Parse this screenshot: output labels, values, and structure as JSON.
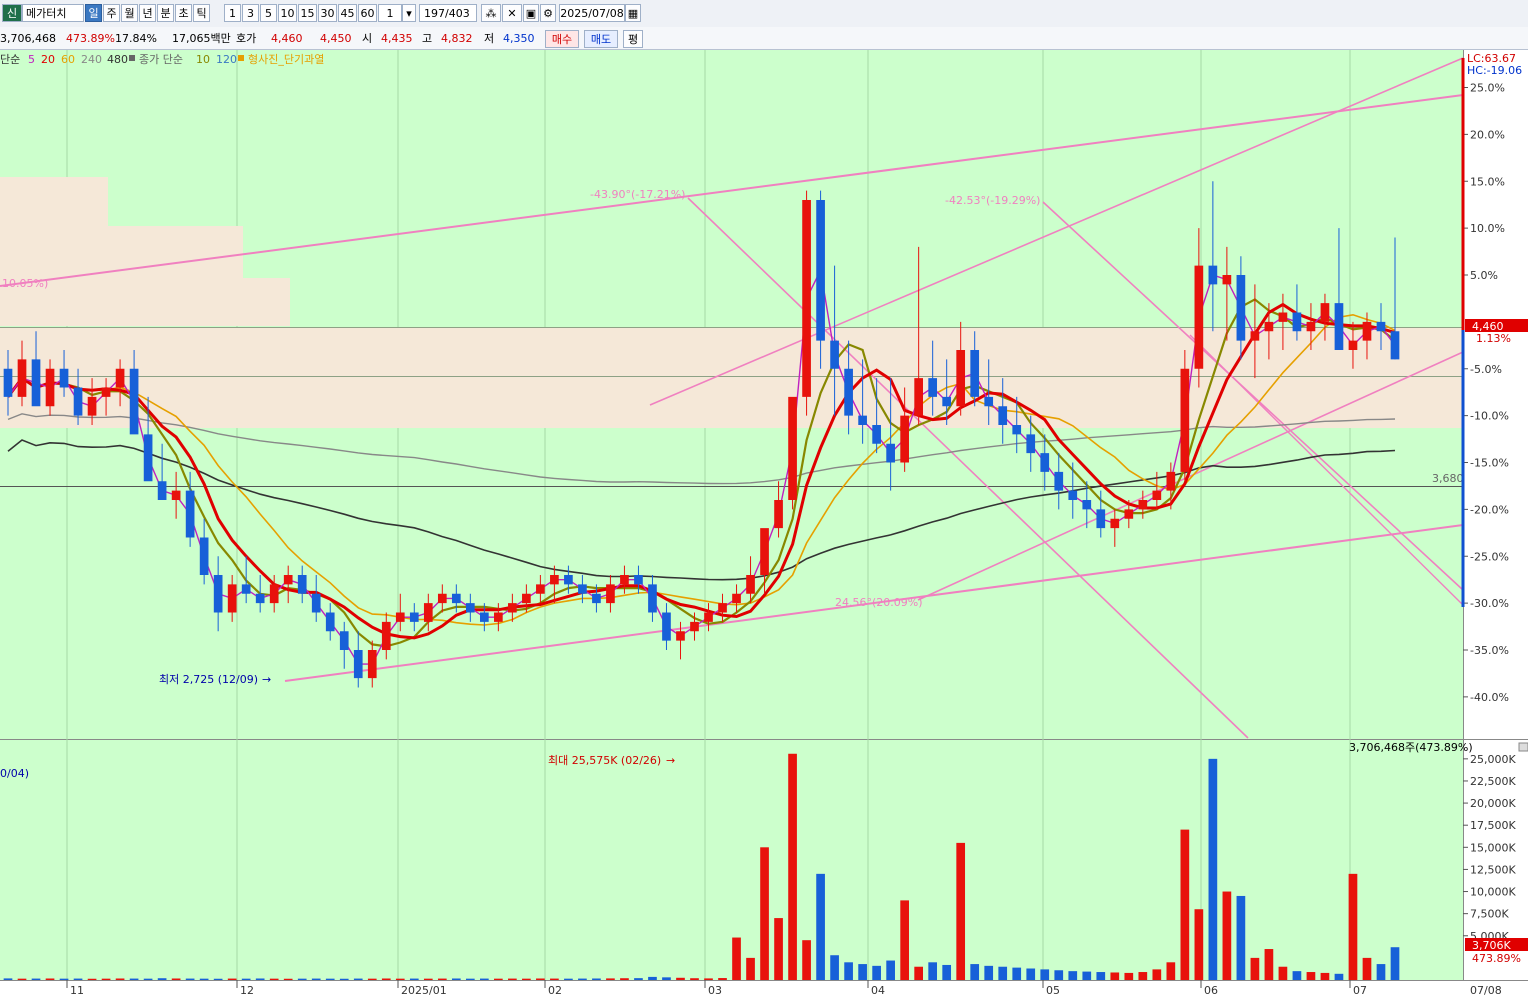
{
  "toolbar": {
    "stock_badge": "신",
    "stock_name": "메가터치",
    "periods": [
      "일",
      "주",
      "월",
      "년",
      "분",
      "초",
      "틱"
    ],
    "selected_period": "일",
    "intervals": [
      "1",
      "3",
      "5",
      "10",
      "15",
      "30",
      "45",
      "60"
    ],
    "interval_value": "1",
    "count_current": "197",
    "count_total": "/403",
    "date": "2025/07/08"
  },
  "info": {
    "volume": "3,706,468",
    "vol_ratio": "473.89%",
    "rate": "17.84%",
    "amount": "17,065백만",
    "hoga_label": "호가",
    "ask": "4,460",
    "bid": "4,450",
    "open_label": "시",
    "open": "4,435",
    "high_label": "고",
    "high": "4,832",
    "low_label": "저",
    "low": "4,350",
    "buy_btn": "매수",
    "sell_btn": "매도",
    "avg_btn": "평"
  },
  "legend": {
    "price_ma_label": "단순",
    "price_ma_periods": [
      "5",
      "20",
      "60",
      "240",
      "480"
    ],
    "price_ma_colors": [
      "#c020c0",
      "#e00000",
      "#e6a000",
      "#888888",
      "#333333"
    ],
    "volume_ma_label": "종가 단순",
    "volume_ma_periods": [
      "10",
      "120"
    ],
    "pattern_label": "형사진_단기과열"
  },
  "annotations": {
    "angle_1": "-43.90°(-17.21%)",
    "angle_2": "-42.53°(-19.29%)",
    "angle_3": "24.56°(20.09%)",
    "angle_left": "10.05%)",
    "low_marker": "최저 2,725 (12/09)",
    "max_volume": "최대 25,575K (02/26)",
    "vol_date_left": "0/04)",
    "ref_price": "3,680",
    "lc": "LC:63.67",
    "hc": "HC:-19.06",
    "last_price": "4,460",
    "last_pct": "1.13%",
    "vol_current": "3,706,468주(473.89%)",
    "vol_tag": "3,706K",
    "vol_tag_pct": "473.89%"
  },
  "chart_data": {
    "type": "candlestick",
    "title": "",
    "x_axis_ticks": [
      "11",
      "12",
      "2025/01",
      "02",
      "03",
      "04",
      "05",
      "06",
      "07",
      "07/08"
    ],
    "price_axis": {
      "format": "percent",
      "ticks": [
        "25.0%",
        "20.0%",
        "15.0%",
        "10.0%",
        "5.0%",
        "-5.0%",
        "-10.0%",
        "-15.0%",
        "-20.0%",
        "-25.0%",
        "-30.0%",
        "-35.0%",
        "-40.0%"
      ]
    },
    "volume_axis": {
      "unit": "K",
      "ticks": [
        "25,000K",
        "22,500K",
        "20,000K",
        "17,500K",
        "15,000K",
        "12,500K",
        "10,000K",
        "7,500K",
        "5,000K"
      ],
      "ylim": [
        0,
        26000
      ]
    },
    "price_ylim": [
      -44.6,
      29.0
    ],
    "candles_pct": [
      [
        -5,
        -3,
        -10,
        -8
      ],
      [
        -8,
        -2,
        -9,
        -4
      ],
      [
        -4,
        -1,
        -8,
        -9
      ],
      [
        -9,
        -4,
        -10,
        -5
      ],
      [
        -5,
        -3,
        -8,
        -7
      ],
      [
        -7,
        -5,
        -11,
        -10
      ],
      [
        -10,
        -6,
        -11,
        -8
      ],
      [
        -8,
        -6,
        -10,
        -7
      ],
      [
        -7,
        -4,
        -9,
        -5
      ],
      [
        -5,
        -3,
        -10,
        -12
      ],
      [
        -12,
        -8,
        -13,
        -17
      ],
      [
        -17,
        -13,
        -19,
        -19
      ],
      [
        -19,
        -16,
        -21,
        -18
      ],
      [
        -18,
        -16,
        -24,
        -23
      ],
      [
        -23,
        -21,
        -28,
        -27
      ],
      [
        -27,
        -25,
        -33,
        -31
      ],
      [
        -31,
        -27,
        -32,
        -28
      ],
      [
        -28,
        -25,
        -30,
        -29
      ],
      [
        -29,
        -27,
        -31,
        -30
      ],
      [
        -30,
        -27,
        -31,
        -28
      ],
      [
        -28,
        -26,
        -30,
        -27
      ],
      [
        -27,
        -26,
        -30,
        -29
      ],
      [
        -29,
        -27,
        -32,
        -31
      ],
      [
        -31,
        -30,
        -34,
        -33
      ],
      [
        -33,
        -32,
        -37,
        -35
      ],
      [
        -35,
        -33,
        -39,
        -38
      ],
      [
        -38,
        -34,
        -39,
        -35
      ],
      [
        -35,
        -31,
        -36,
        -32
      ],
      [
        -32,
        -29,
        -33,
        -31
      ],
      [
        -31,
        -30,
        -33,
        -32
      ],
      [
        -32,
        -29,
        -33,
        -30
      ],
      [
        -30,
        -28,
        -31,
        -29
      ],
      [
        -29,
        -28,
        -31,
        -30
      ],
      [
        -30,
        -29,
        -32,
        -31
      ],
      [
        -31,
        -30,
        -33,
        -32
      ],
      [
        -32,
        -30,
        -33,
        -31
      ],
      [
        -31,
        -29,
        -32,
        -30
      ],
      [
        -30,
        -28,
        -31,
        -29
      ],
      [
        -29,
        -27,
        -30,
        -28
      ],
      [
        -28,
        -26,
        -30,
        -27
      ],
      [
        -27,
        -26,
        -29,
        -28
      ],
      [
        -28,
        -27,
        -30,
        -29
      ],
      [
        -29,
        -28,
        -31,
        -30
      ],
      [
        -30,
        -27,
        -31,
        -28
      ],
      [
        -28,
        -26,
        -29,
        -27
      ],
      [
        -27,
        -26,
        -29,
        -28
      ],
      [
        -28,
        -27,
        -32,
        -31
      ],
      [
        -31,
        -30,
        -35,
        -34
      ],
      [
        -34,
        -32,
        -36,
        -33
      ],
      [
        -33,
        -31,
        -34,
        -32
      ],
      [
        -32,
        -30,
        -33,
        -31
      ],
      [
        -31,
        -29,
        -32,
        -30
      ],
      [
        -30,
        -28,
        -31,
        -29
      ],
      [
        -29,
        -25,
        -30,
        -27
      ],
      [
        -27,
        -23,
        -29,
        -22
      ],
      [
        -22,
        -17,
        -23,
        -19
      ],
      [
        -19,
        -9,
        -20,
        -8
      ],
      [
        -8,
        14,
        -10,
        13
      ],
      [
        13,
        14,
        -5,
        -2
      ],
      [
        -2,
        6,
        -10,
        -5
      ],
      [
        -5,
        -2,
        -12,
        -10
      ],
      [
        -10,
        -4,
        -13,
        -11
      ],
      [
        -11,
        -6,
        -14,
        -13
      ],
      [
        -13,
        -6,
        -18,
        -15
      ],
      [
        -15,
        -7,
        -16,
        -10
      ],
      [
        -10,
        8,
        -11,
        -6
      ],
      [
        -6,
        -2,
        -10,
        -8
      ],
      [
        -8,
        -4,
        -11,
        -9
      ],
      [
        -9,
        0,
        -10,
        -3
      ],
      [
        -3,
        -1,
        -9,
        -8
      ],
      [
        -8,
        -4,
        -11,
        -9
      ],
      [
        -9,
        -6,
        -13,
        -11
      ],
      [
        -11,
        -8,
        -14,
        -12
      ],
      [
        -12,
        -10,
        -16,
        -14
      ],
      [
        -14,
        -12,
        -18,
        -16
      ],
      [
        -16,
        -14,
        -20,
        -18
      ],
      [
        -18,
        -15,
        -21,
        -19
      ],
      [
        -19,
        -17,
        -22,
        -20
      ],
      [
        -20,
        -18,
        -23,
        -22
      ],
      [
        -22,
        -20,
        -24,
        -21
      ],
      [
        -21,
        -19,
        -22,
        -20
      ],
      [
        -20,
        -18,
        -21,
        -19
      ],
      [
        -19,
        -16,
        -20,
        -18
      ],
      [
        -18,
        -15,
        -20,
        -16
      ],
      [
        -16,
        -3,
        -17,
        -5
      ],
      [
        -5,
        10,
        -7,
        6
      ],
      [
        6,
        15,
        -1,
        4
      ],
      [
        4,
        8,
        -2,
        5
      ],
      [
        5,
        7,
        -4,
        -2
      ],
      [
        -2,
        4,
        -6,
        -1
      ],
      [
        -1,
        2,
        -4,
        0
      ],
      [
        0,
        3,
        -3,
        1
      ],
      [
        1,
        4,
        -2,
        -1
      ],
      [
        -1,
        2,
        -3,
        0
      ],
      [
        0,
        3,
        -2,
        2
      ],
      [
        2,
        10,
        -3,
        -3
      ],
      [
        -3,
        0,
        -5,
        -2
      ],
      [
        -2,
        1,
        -4,
        0
      ],
      [
        0,
        2,
        -3,
        -1
      ],
      [
        -1,
        9,
        -4,
        -4
      ]
    ],
    "volume_k": [
      180,
      150,
      160,
      170,
      150,
      160,
      140,
      150,
      170,
      160,
      150,
      200,
      170,
      160,
      150,
      140,
      160,
      150,
      170,
      150,
      140,
      150,
      160,
      150,
      140,
      160,
      150,
      170,
      150,
      160,
      150,
      160,
      170,
      150,
      160,
      150,
      160,
      150,
      170,
      160,
      150,
      160,
      170,
      180,
      200,
      210,
      350,
      300,
      250,
      200,
      180,
      220,
      4800,
      2500,
      15000,
      7000,
      25575,
      4500,
      12000,
      2800,
      2000,
      1800,
      1600,
      2200,
      9000,
      1500,
      2000,
      1700,
      15500,
      1800,
      1600,
      1500,
      1400,
      1300,
      1200,
      1100,
      1000,
      950,
      900,
      850,
      800,
      900,
      1200,
      2000,
      17000,
      8000,
      25000,
      10000,
      9500,
      2500,
      3500,
      1500,
      1000,
      900,
      800,
      700,
      12000,
      2500,
      1800,
      3706
    ],
    "series": [
      {
        "name": "5",
        "color": "#c020c0"
      },
      {
        "name": "20",
        "color": "#e00000"
      },
      {
        "name": "60",
        "color": "#e6a000"
      },
      {
        "name": "240",
        "color": "#888888"
      },
      {
        "name": "480",
        "color": "#333333"
      }
    ],
    "grid": true,
    "legend_position": "top-left"
  }
}
